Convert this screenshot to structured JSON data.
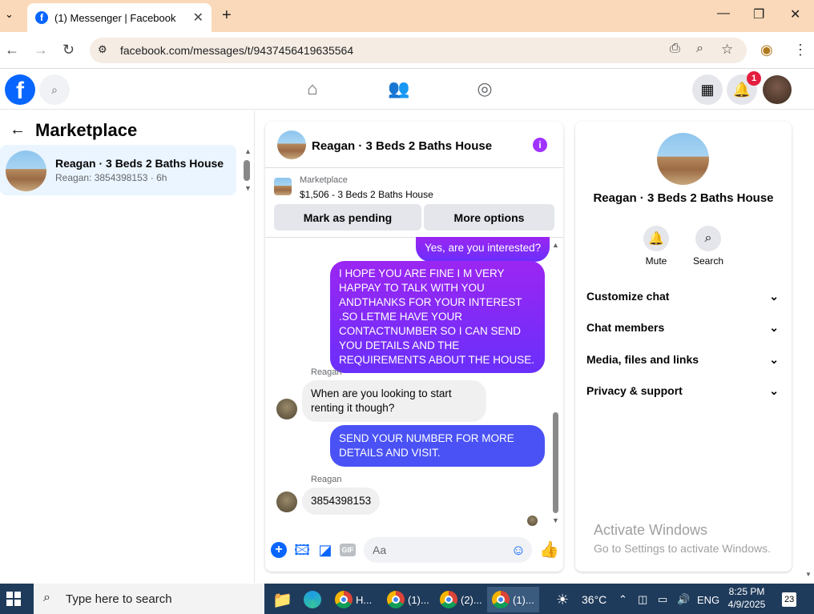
{
  "browser": {
    "tab_title": "(1) Messenger | Facebook",
    "url": "facebook.com/messages/t/9437456419635564"
  },
  "fb": {
    "notif_count": "1"
  },
  "left": {
    "title": "Marketplace",
    "conversation": {
      "name": "Reagan · 3 Beds 2 Baths House",
      "subtitle": "Reagan: 3854398153 · 6h"
    }
  },
  "chat": {
    "title": "Reagan · 3 Beds 2 Baths House",
    "listing_category": "Marketplace",
    "listing_price": "$1,506 - 3 Beds 2 Baths House",
    "mark_pending_label": "Mark as pending",
    "more_options_label": "More options",
    "messages": [
      {
        "from": "me",
        "text": "Yes, are you interested?"
      },
      {
        "from": "me",
        "text": "I HOPE YOU ARE FINE I M VERY HAPPAY TO TALK WITH YOU ANDTHANKS FOR YOUR INTEREST .SO LETME HAVE YOUR CONTACTNUMBER SO I CAN SEND YOU DETAILS AND THE REQUIREMENTS ABOUT THE HOUSE."
      },
      {
        "from": "Reagan",
        "text": "When are you looking to start renting it though?"
      },
      {
        "from": "me",
        "text": "SEND YOUR NUMBER FOR MORE DETAILS AND VISIT."
      },
      {
        "from": "Reagan",
        "text": "3854398153"
      }
    ],
    "sender_label": "Reagan",
    "composer_placeholder": "Aa"
  },
  "right": {
    "name": "Reagan · 3 Beds 2 Baths House",
    "mute_label": "Mute",
    "search_label": "Search",
    "sections": [
      "Customize chat",
      "Chat members",
      "Media, files and links",
      "Privacy & support"
    ]
  },
  "watermark": {
    "line1": "Activate Windows",
    "line2": "Go to Settings to activate Windows."
  },
  "taskbar": {
    "search_placeholder": "Type here to search",
    "apps": [
      "H...",
      "(1)...",
      "(2)...",
      "(1)..."
    ],
    "temperature": "36°C",
    "language": "ENG",
    "time": "8:25 PM",
    "date": "4/9/2025",
    "notif_count": "23"
  }
}
